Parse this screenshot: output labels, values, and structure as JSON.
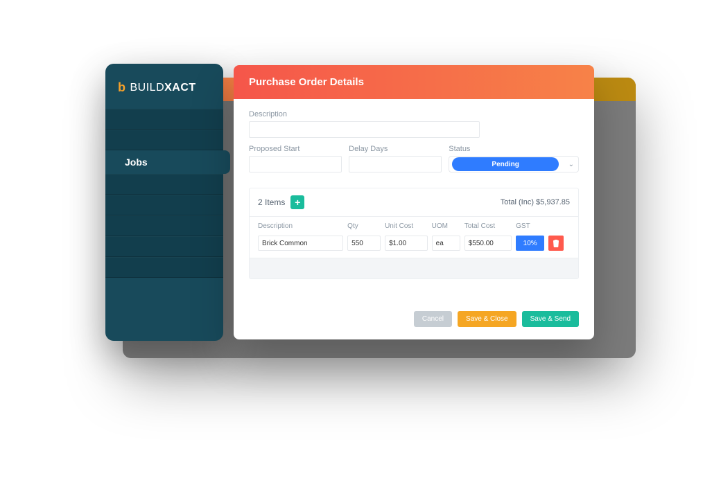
{
  "brand": {
    "b": "b",
    "build": "BUILD",
    "xact": "XACT"
  },
  "sidebar": {
    "active_label": "Jobs"
  },
  "modal": {
    "title": "Purchase Order Details",
    "labels": {
      "description": "Description",
      "proposed_start": "Proposed Start",
      "delay_days": "Delay Days",
      "status": "Status"
    },
    "fields": {
      "description": "",
      "proposed_start": "",
      "delay_days": ""
    },
    "status": {
      "value": "Pending"
    }
  },
  "items": {
    "count_label": "2 Items",
    "total_label": "Total (Inc) $5,937.85",
    "columns": {
      "description": "Description",
      "qty": "Qty",
      "unit_cost": "Unit Cost",
      "uom": "UOM",
      "total_cost": "Total Cost",
      "gst": "GST"
    },
    "rows": [
      {
        "description": "Brick Common",
        "qty": "550",
        "unit_cost": "$1.00",
        "uom": "ea",
        "total_cost": "$550.00",
        "gst": "10%"
      }
    ]
  },
  "footer": {
    "cancel": "Cancel",
    "save_close": "Save & Close",
    "save_send": "Save & Send"
  }
}
